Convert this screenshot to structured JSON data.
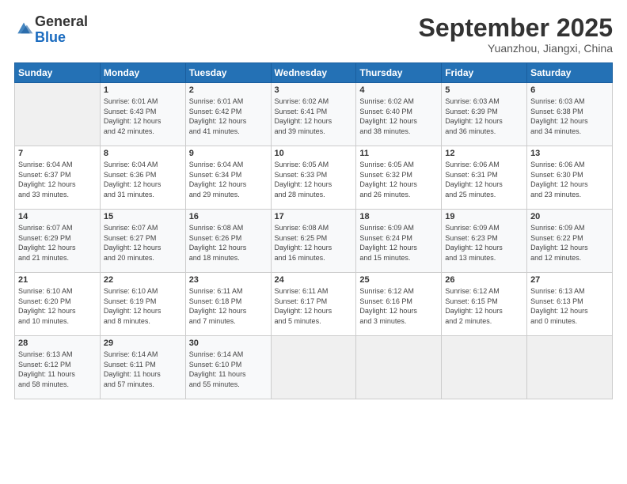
{
  "logo": {
    "general": "General",
    "blue": "Blue"
  },
  "title": "September 2025",
  "subtitle": "Yuanzhou, Jiangxi, China",
  "days_of_week": [
    "Sunday",
    "Monday",
    "Tuesday",
    "Wednesday",
    "Thursday",
    "Friday",
    "Saturday"
  ],
  "weeks": [
    [
      {
        "day": "",
        "info": ""
      },
      {
        "day": "1",
        "info": "Sunrise: 6:01 AM\nSunset: 6:43 PM\nDaylight: 12 hours\nand 42 minutes."
      },
      {
        "day": "2",
        "info": "Sunrise: 6:01 AM\nSunset: 6:42 PM\nDaylight: 12 hours\nand 41 minutes."
      },
      {
        "day": "3",
        "info": "Sunrise: 6:02 AM\nSunset: 6:41 PM\nDaylight: 12 hours\nand 39 minutes."
      },
      {
        "day": "4",
        "info": "Sunrise: 6:02 AM\nSunset: 6:40 PM\nDaylight: 12 hours\nand 38 minutes."
      },
      {
        "day": "5",
        "info": "Sunrise: 6:03 AM\nSunset: 6:39 PM\nDaylight: 12 hours\nand 36 minutes."
      },
      {
        "day": "6",
        "info": "Sunrise: 6:03 AM\nSunset: 6:38 PM\nDaylight: 12 hours\nand 34 minutes."
      }
    ],
    [
      {
        "day": "7",
        "info": "Sunrise: 6:04 AM\nSunset: 6:37 PM\nDaylight: 12 hours\nand 33 minutes."
      },
      {
        "day": "8",
        "info": "Sunrise: 6:04 AM\nSunset: 6:36 PM\nDaylight: 12 hours\nand 31 minutes."
      },
      {
        "day": "9",
        "info": "Sunrise: 6:04 AM\nSunset: 6:34 PM\nDaylight: 12 hours\nand 29 minutes."
      },
      {
        "day": "10",
        "info": "Sunrise: 6:05 AM\nSunset: 6:33 PM\nDaylight: 12 hours\nand 28 minutes."
      },
      {
        "day": "11",
        "info": "Sunrise: 6:05 AM\nSunset: 6:32 PM\nDaylight: 12 hours\nand 26 minutes."
      },
      {
        "day": "12",
        "info": "Sunrise: 6:06 AM\nSunset: 6:31 PM\nDaylight: 12 hours\nand 25 minutes."
      },
      {
        "day": "13",
        "info": "Sunrise: 6:06 AM\nSunset: 6:30 PM\nDaylight: 12 hours\nand 23 minutes."
      }
    ],
    [
      {
        "day": "14",
        "info": "Sunrise: 6:07 AM\nSunset: 6:29 PM\nDaylight: 12 hours\nand 21 minutes."
      },
      {
        "day": "15",
        "info": "Sunrise: 6:07 AM\nSunset: 6:27 PM\nDaylight: 12 hours\nand 20 minutes."
      },
      {
        "day": "16",
        "info": "Sunrise: 6:08 AM\nSunset: 6:26 PM\nDaylight: 12 hours\nand 18 minutes."
      },
      {
        "day": "17",
        "info": "Sunrise: 6:08 AM\nSunset: 6:25 PM\nDaylight: 12 hours\nand 16 minutes."
      },
      {
        "day": "18",
        "info": "Sunrise: 6:09 AM\nSunset: 6:24 PM\nDaylight: 12 hours\nand 15 minutes."
      },
      {
        "day": "19",
        "info": "Sunrise: 6:09 AM\nSunset: 6:23 PM\nDaylight: 12 hours\nand 13 minutes."
      },
      {
        "day": "20",
        "info": "Sunrise: 6:09 AM\nSunset: 6:22 PM\nDaylight: 12 hours\nand 12 minutes."
      }
    ],
    [
      {
        "day": "21",
        "info": "Sunrise: 6:10 AM\nSunset: 6:20 PM\nDaylight: 12 hours\nand 10 minutes."
      },
      {
        "day": "22",
        "info": "Sunrise: 6:10 AM\nSunset: 6:19 PM\nDaylight: 12 hours\nand 8 minutes."
      },
      {
        "day": "23",
        "info": "Sunrise: 6:11 AM\nSunset: 6:18 PM\nDaylight: 12 hours\nand 7 minutes."
      },
      {
        "day": "24",
        "info": "Sunrise: 6:11 AM\nSunset: 6:17 PM\nDaylight: 12 hours\nand 5 minutes."
      },
      {
        "day": "25",
        "info": "Sunrise: 6:12 AM\nSunset: 6:16 PM\nDaylight: 12 hours\nand 3 minutes."
      },
      {
        "day": "26",
        "info": "Sunrise: 6:12 AM\nSunset: 6:15 PM\nDaylight: 12 hours\nand 2 minutes."
      },
      {
        "day": "27",
        "info": "Sunrise: 6:13 AM\nSunset: 6:13 PM\nDaylight: 12 hours\nand 0 minutes."
      }
    ],
    [
      {
        "day": "28",
        "info": "Sunrise: 6:13 AM\nSunset: 6:12 PM\nDaylight: 11 hours\nand 58 minutes."
      },
      {
        "day": "29",
        "info": "Sunrise: 6:14 AM\nSunset: 6:11 PM\nDaylight: 11 hours\nand 57 minutes."
      },
      {
        "day": "30",
        "info": "Sunrise: 6:14 AM\nSunset: 6:10 PM\nDaylight: 11 hours\nand 55 minutes."
      },
      {
        "day": "",
        "info": ""
      },
      {
        "day": "",
        "info": ""
      },
      {
        "day": "",
        "info": ""
      },
      {
        "day": "",
        "info": ""
      }
    ]
  ]
}
